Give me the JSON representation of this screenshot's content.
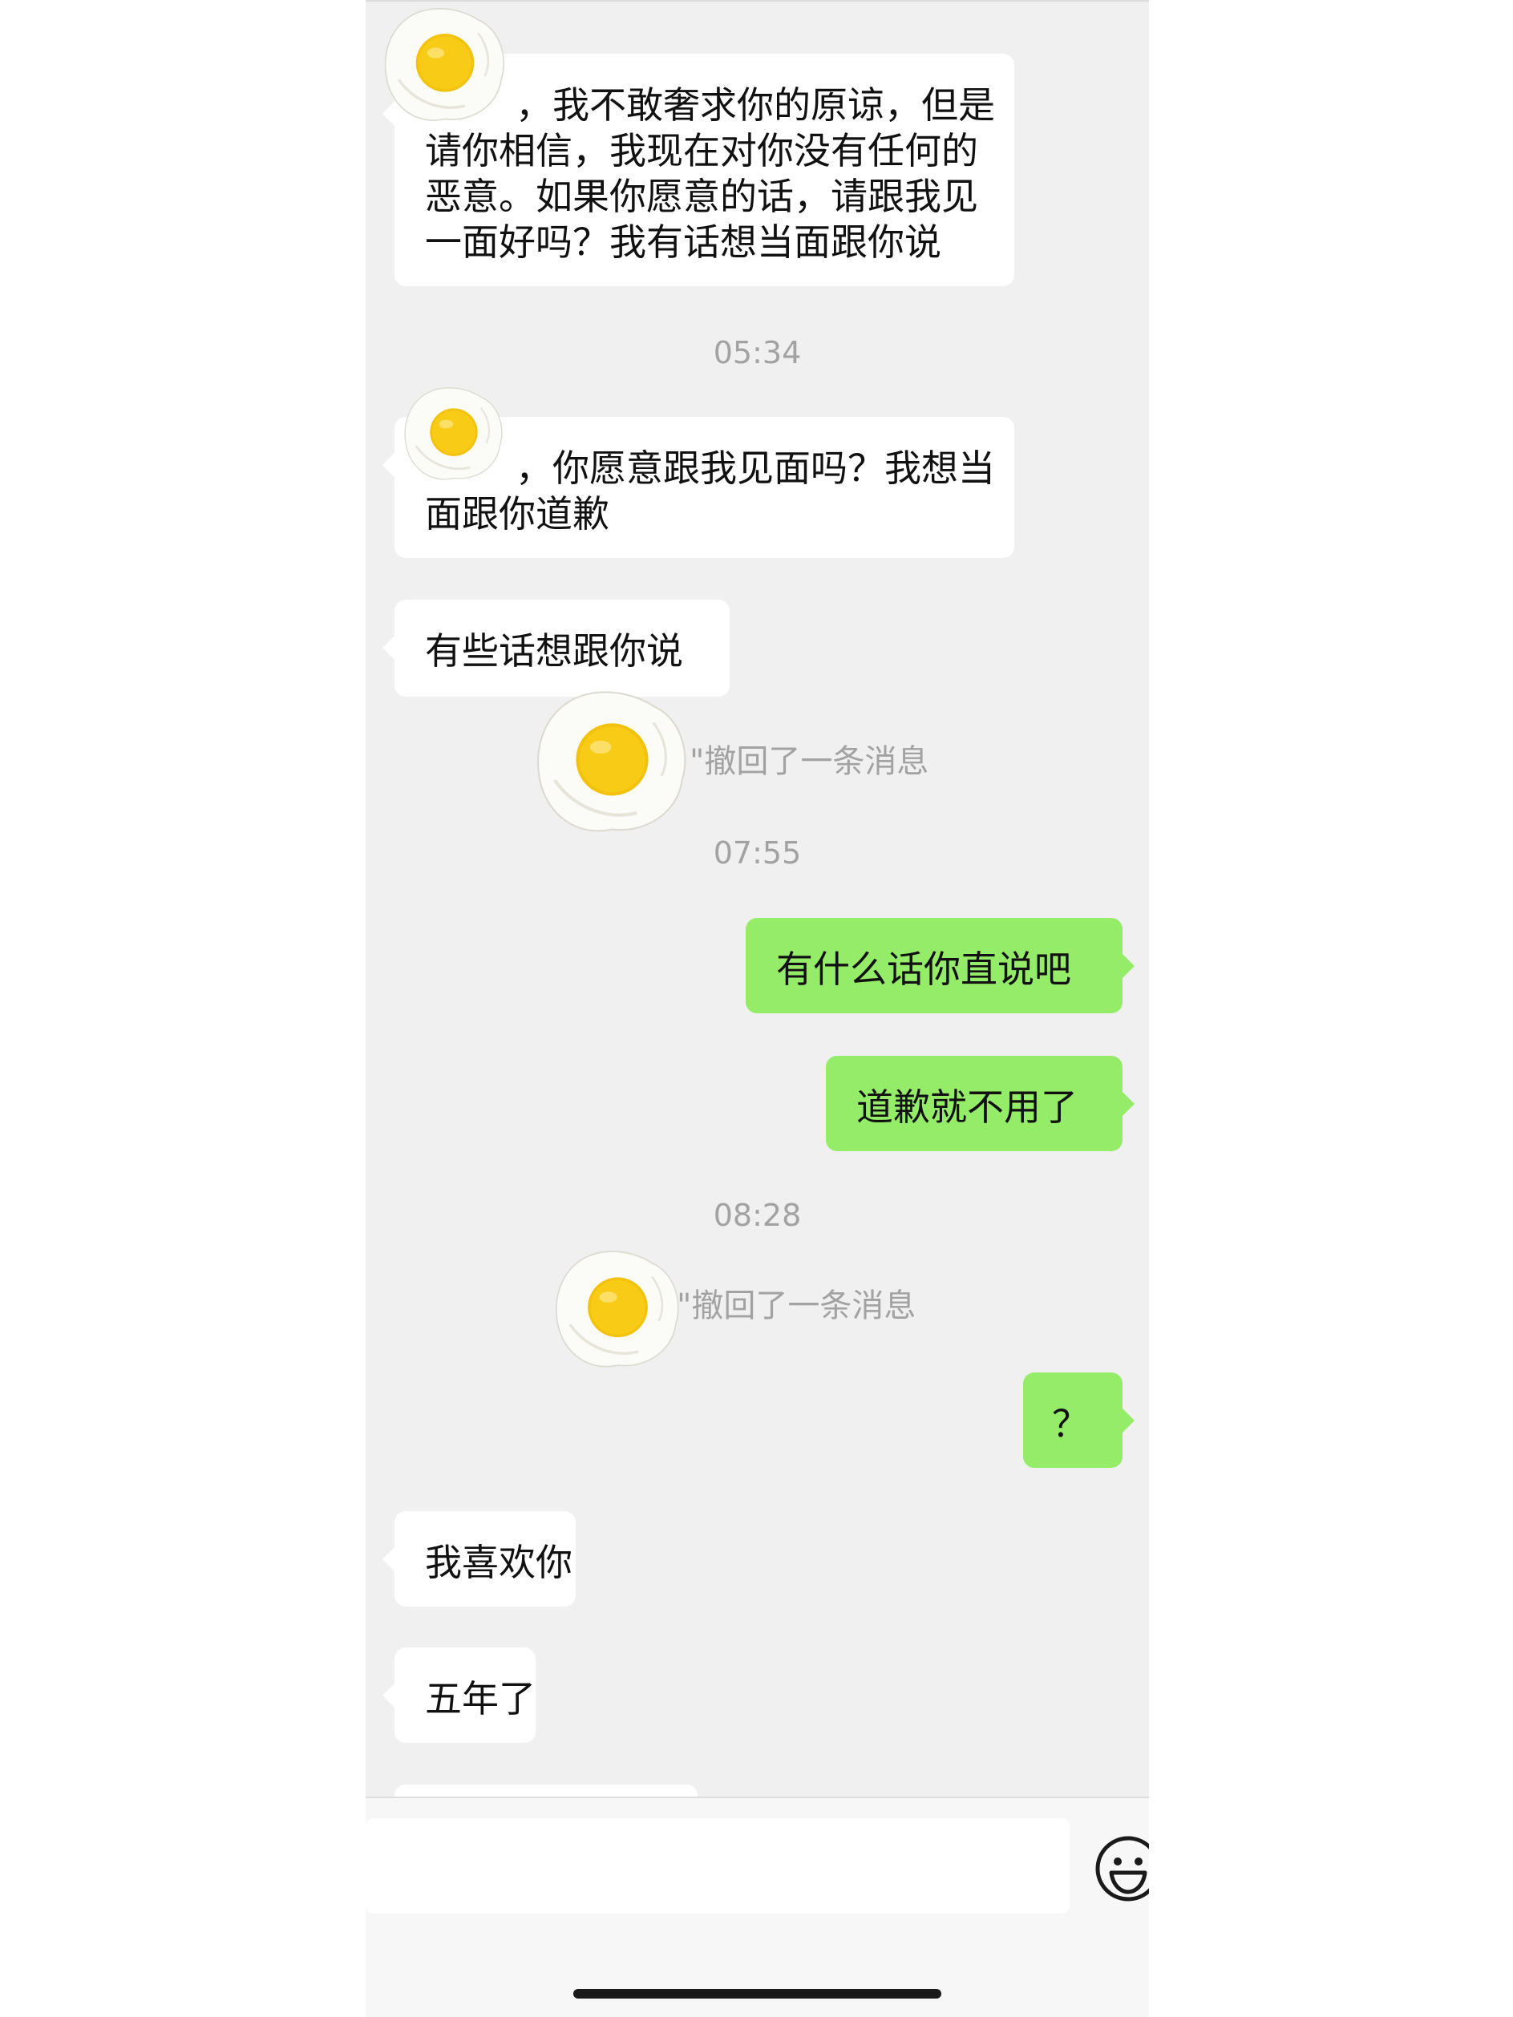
{
  "messages": {
    "m1_lines": [
      "，我不敢奢求你的原谅，但是",
      "请你相信，我现在对你没有任何的",
      "恶意。如果你愿意的话，请跟我见",
      "一面好吗？我有话想当面跟你说"
    ],
    "time1": "05:34",
    "m2_lines": [
      "，你愿意跟我见面吗？我想当",
      "面跟你道歉"
    ],
    "m3": "有些话想跟你说",
    "recall1": "\"撤回了一条消息",
    "time2": "07:55",
    "m4": "有什么话你直说吧",
    "m5": "道歉就不用了",
    "time3": "08:28",
    "recall2": "\"撤回了一条消息",
    "m6": "？",
    "m7": "我喜欢你",
    "m8": "五年了"
  },
  "stickers": [
    "fried-egg",
    "fried-egg",
    "fried-egg",
    "fried-egg"
  ],
  "input_bar": {
    "emoji_icon": "smiley-icon",
    "input_value": ""
  },
  "colors": {
    "chat_bg": "#f0f0f0",
    "incoming_bubble": "#ffffff",
    "outgoing_bubble": "#95ec69",
    "meta_text": "#a2a2a2"
  }
}
